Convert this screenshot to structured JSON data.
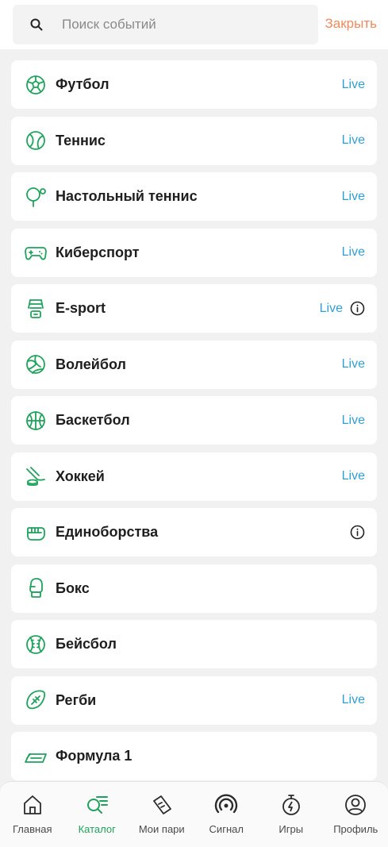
{
  "search": {
    "placeholder": "Поиск событий",
    "close_label": "Закрыть"
  },
  "sports": [
    {
      "name": "Футбол",
      "icon": "football-icon",
      "live": "Live",
      "info": false
    },
    {
      "name": "Теннис",
      "icon": "tennis-ball-icon",
      "live": "Live",
      "info": false
    },
    {
      "name": "Настольный теннис",
      "icon": "table-tennis-icon",
      "live": "Live",
      "info": false
    },
    {
      "name": "Киберспорт",
      "icon": "gamepad-icon",
      "live": "Live",
      "info": false
    },
    {
      "name": "E-sport",
      "icon": "esport-icon",
      "live": "Live",
      "info": true
    },
    {
      "name": "Волейбол",
      "icon": "volleyball-icon",
      "live": "Live",
      "info": false
    },
    {
      "name": "Баскетбол",
      "icon": "basketball-icon",
      "live": "Live",
      "info": false
    },
    {
      "name": "Хоккей",
      "icon": "hockey-icon",
      "live": "Live",
      "info": false
    },
    {
      "name": "Единоборства",
      "icon": "martial-arts-icon",
      "live": "",
      "info": true
    },
    {
      "name": "Бокс",
      "icon": "boxing-glove-icon",
      "live": "",
      "info": false
    },
    {
      "name": "Бейсбол",
      "icon": "baseball-icon",
      "live": "",
      "info": false
    },
    {
      "name": "Регби",
      "icon": "rugby-ball-icon",
      "live": "Live",
      "info": false
    },
    {
      "name": "Формула 1",
      "icon": "formula1-icon",
      "live": "",
      "info": false
    }
  ],
  "tabs": [
    {
      "label": "Главная",
      "icon": "home-icon",
      "active": false
    },
    {
      "label": "Каталог",
      "icon": "catalog-icon",
      "active": true
    },
    {
      "label": "Мои пари",
      "icon": "bet-ticket-icon",
      "active": false
    },
    {
      "label": "Сигнал",
      "icon": "signal-icon",
      "active": false
    },
    {
      "label": "Игры",
      "icon": "stopwatch-icon",
      "active": false
    },
    {
      "label": "Профиль",
      "icon": "profile-icon",
      "active": false
    }
  ],
  "colors": {
    "accent": "#1fa35c",
    "live": "#2f9fd6",
    "close": "#ef8a5c"
  }
}
